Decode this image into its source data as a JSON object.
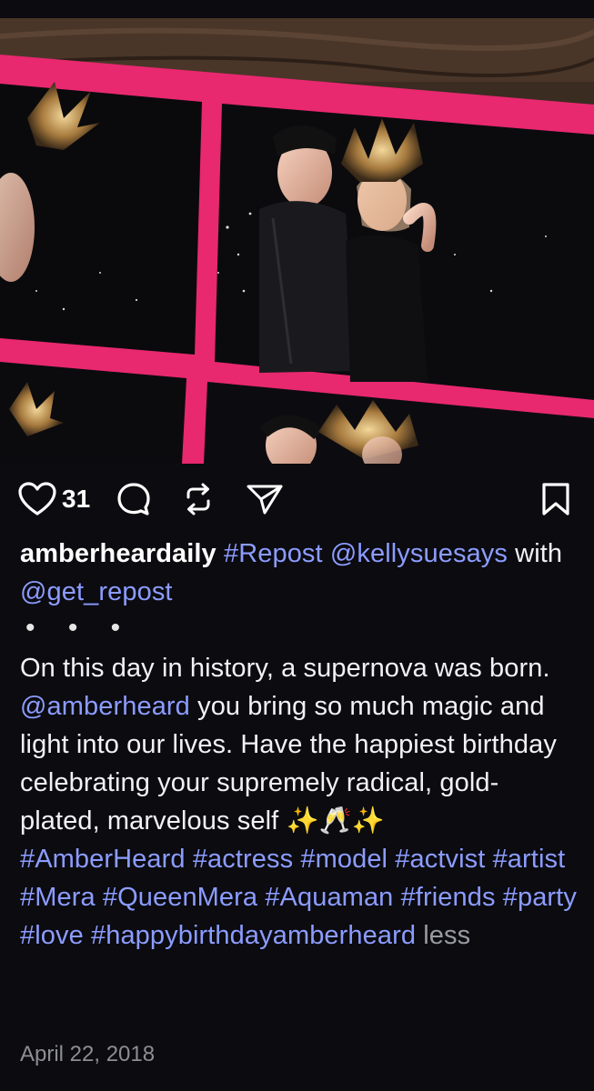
{
  "post": {
    "like_count": "31",
    "username": "amberheardaily",
    "repost_tag": "#Repost",
    "repost_handle": "@kellysuesays",
    "with_text": "with",
    "via_handle": "@get_repost",
    "dots": "• • •",
    "body_part1": "On this day in history, a supernova was born.",
    "mention": "@amberheard",
    "body_part2": "you bring so much magic and light into our lives. Have the happiest birthday celebrating your supremely radical, gold-plated, marvelous self ✨🥂✨",
    "hashtags": [
      "#AmberHeard",
      "#actress",
      "#model",
      "#actvist",
      "#artist",
      "#Mera",
      "#QueenMera",
      "#Aquaman",
      "#friends",
      "#party",
      "#love",
      "#happybirthdayamberheard"
    ],
    "less_label": "less",
    "date": "April 22, 2018"
  },
  "colors": {
    "background": "#0b0b10",
    "link": "#8c9cff",
    "muted": "#8d8d95",
    "frame_pink": "#e8286f"
  },
  "icons": {
    "like": "heart-icon",
    "comment": "comment-bubble-icon",
    "repost": "repost-arrows-icon",
    "share": "send-paper-plane-icon",
    "save": "bookmark-icon"
  }
}
